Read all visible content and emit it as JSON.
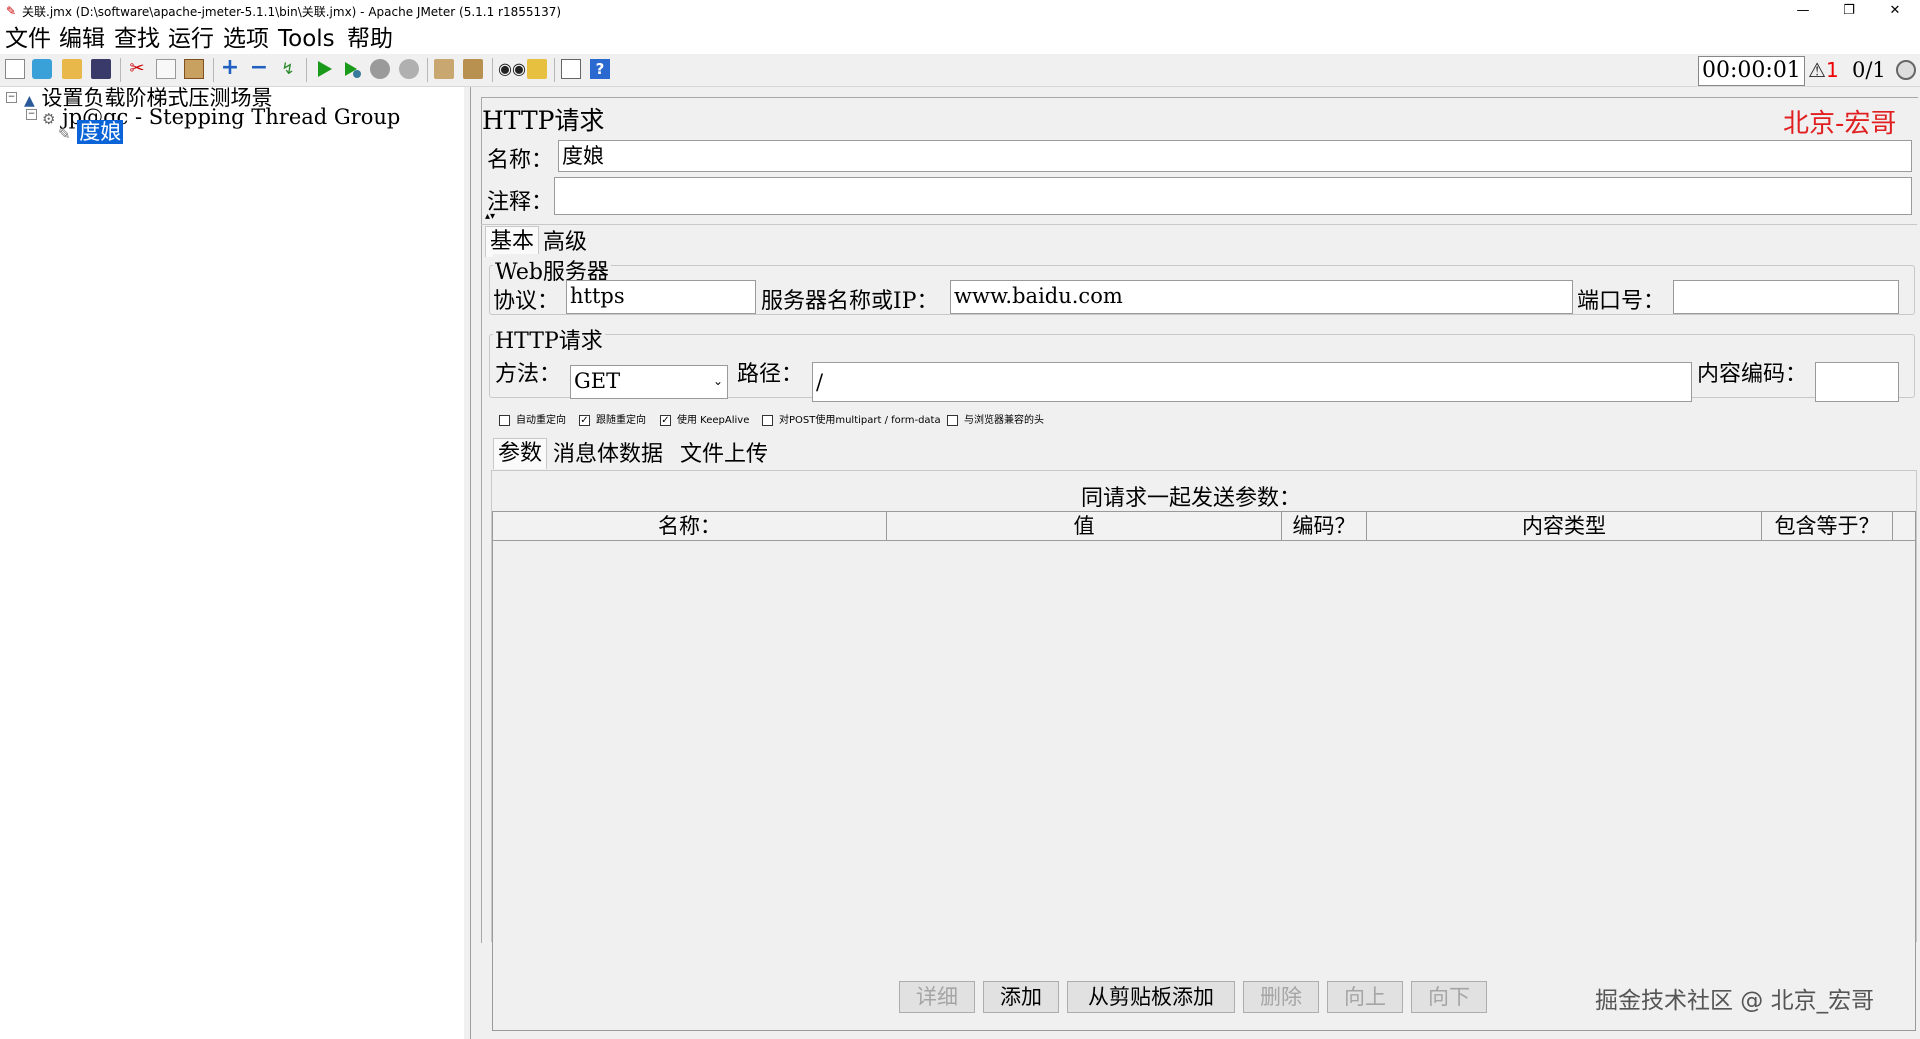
{
  "window": {
    "title": "关联.jmx (D:\\software\\apache-jmeter-5.1.1\\bin\\关联.jmx) - Apache JMeter (5.1.1 r1855137)",
    "minimize_glyph": "—",
    "maximize_glyph": "❐",
    "close_glyph": "✕"
  },
  "menu": [
    "文件",
    "编辑",
    "查找",
    "运行",
    "选项",
    "Tools",
    "帮助"
  ],
  "toolbar": {
    "icons": [
      "new-file-icon",
      "templates-icon",
      "open-icon",
      "save-icon",
      "cut-icon",
      "copy-icon",
      "paste-icon",
      "expand-icon",
      "collapse-icon",
      "toggle-icon",
      "start-icon",
      "start-no-pause-icon",
      "stop-icon",
      "shutdown-icon",
      "clear-icon",
      "clear-all-icon",
      "search-icon",
      "reset-search-icon",
      "function-helper-icon",
      "help-icon"
    ]
  },
  "status": {
    "timer": "00:00:01",
    "warning_count": "1",
    "threads": "0/1"
  },
  "tree": {
    "root": "设置负载阶梯式压测场景",
    "thread_group": "jp@gc - Stepping Thread Group",
    "sampler": "度娘"
  },
  "panel": {
    "title": "HTTP请求",
    "watermark": "北京-宏哥",
    "name_label": "名称：",
    "name_value": "度娘",
    "comment_label": "注释：",
    "comment_value": "",
    "tabs": [
      "基本",
      "高级"
    ],
    "web_server": {
      "legend": "Web服务器",
      "protocol_label": "协议：",
      "protocol_value": "https",
      "server_label": "服务器名称或IP：",
      "server_value": "www.baidu.com",
      "port_label": "端口号：",
      "port_value": ""
    },
    "http_request": {
      "legend": "HTTP请求",
      "method_label": "方法：",
      "method_value": "GET",
      "path_label": "路径：",
      "path_value": "/",
      "encoding_label": "内容编码：",
      "encoding_value": ""
    },
    "checkboxes": [
      {
        "label": "自动重定向",
        "checked": false
      },
      {
        "label": "跟随重定向",
        "checked": true
      },
      {
        "label": "使用 KeepAlive",
        "checked": true
      },
      {
        "label": "对POST使用multipart / form-data",
        "checked": false
      },
      {
        "label": "与浏览器兼容的头",
        "checked": false
      }
    ],
    "subtabs": [
      "参数",
      "消息体数据",
      "文件上传"
    ],
    "params_caption": "同请求一起发送参数：",
    "table_headers": [
      "名称：",
      "值",
      "编码？",
      "内容类型",
      "包含等于？"
    ],
    "buttons": [
      {
        "label": "详细",
        "enabled": false
      },
      {
        "label": "添加",
        "enabled": true
      },
      {
        "label": "从剪贴板添加",
        "enabled": true
      },
      {
        "label": "删除",
        "enabled": false
      },
      {
        "label": "向上",
        "enabled": false
      },
      {
        "label": "向下",
        "enabled": false
      }
    ],
    "footer_watermark": "掘金技术社区 @ 北京_宏哥"
  },
  "colors": {
    "selection": "#0a64d8",
    "watermark_red": "#e02020",
    "start_green": "#1a9a1a"
  }
}
